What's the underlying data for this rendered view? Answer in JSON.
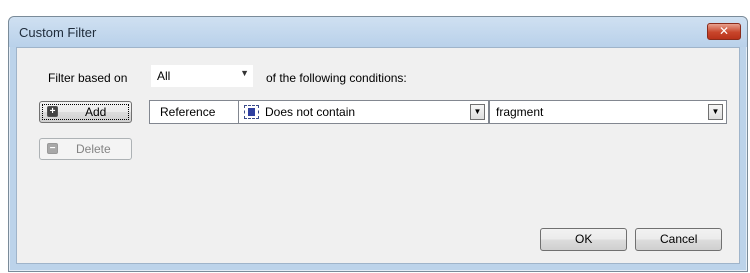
{
  "window": {
    "title": "Custom Filter",
    "close_glyph": "✕"
  },
  "filter": {
    "based_on_label": "Filter based on",
    "mode_value": "All",
    "suffix_label": "of the following conditions:"
  },
  "buttons": {
    "add_label": "Add",
    "delete_label": "Delete",
    "ok_label": "OK",
    "cancel_label": "Cancel"
  },
  "condition": {
    "field": "Reference",
    "operator": "Does not contain",
    "value": "fragment"
  },
  "icons": {
    "add": "+",
    "delete": "−",
    "dropdown": "▼"
  },
  "colors": {
    "title_bar": "#b9d1ea",
    "close_button": "#c8452b",
    "client_background": "#f0f0f0"
  }
}
